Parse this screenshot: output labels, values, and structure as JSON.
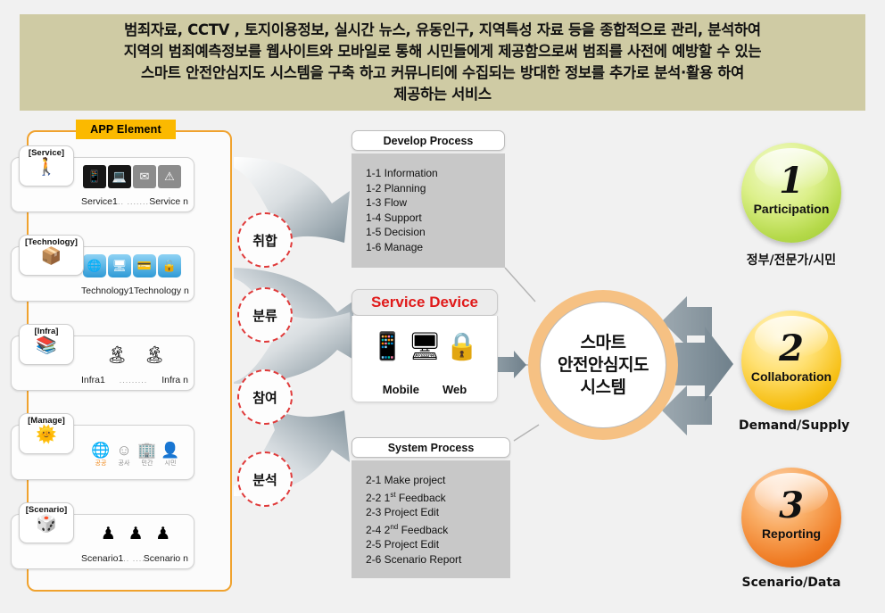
{
  "header": {
    "lines": [
      "범죄자료, CCTV , 토지이용정보, 실시간 뉴스, 유동인구, 지역특성 자료 등을 종합적으로 관리, 분석하여",
      "지역의 범죄예측정보를 웹사이트와 모바일로 통해 시민들에게 제공함으로써 범죄를 사전에 예방할 수 있는",
      "스마트 안전안심지도 시스템을 구축 하고 커뮤니티에 수집되는 방대한 정보를 추가로 분석·활용 하여",
      "제공하는 서비스"
    ],
    "bg_color": "#cfcba4"
  },
  "app_panel": {
    "tab_label": "APP Element",
    "tab_color": "#fbb900",
    "border_color": "#f0a22e",
    "rows": [
      {
        "tag": "[Service]",
        "tag_icon": "person-service-icon",
        "icons": [
          "service-icon-1",
          "service-icon-2",
          "service-icon-3",
          "service-icon-4"
        ],
        "caption_left": "Service1",
        "caption_dots": ".. .......",
        "caption_right": "Service n"
      },
      {
        "tag": "[Technology]",
        "tag_icon": "layers-icon",
        "icons": [
          "network-icon",
          "monitor-icon",
          "card-icon",
          "lock-icon"
        ],
        "caption_left": "Technology1",
        "caption_dots": "...",
        "caption_right": "Technology n"
      },
      {
        "tag": "[Infra]",
        "tag_icon": "books-icon",
        "icons": [
          "land-icon-1",
          "land-icon-2"
        ],
        "caption_left": "Infra1",
        "caption_dots": ".........",
        "caption_right": "Infra n"
      },
      {
        "tag": "[Manage]",
        "tag_icon": "manage-hand-icon",
        "icons": [
          "globe-icon",
          "smile-icon",
          "building-icon",
          "citizen-icon"
        ],
        "icon_labels": [
          "공공",
          "공사",
          "민간",
          "시민"
        ],
        "caption_left": "",
        "caption_dots": "",
        "caption_right": ""
      },
      {
        "tag": "[Scenario]",
        "tag_icon": "dice-icon",
        "icons": [
          "figure-icon-1",
          "figure-icon-2",
          "figure-icon-3"
        ],
        "caption_left": "Scenario1",
        "caption_dots": ".. .....",
        "caption_right": "Scenario n"
      }
    ]
  },
  "flow_steps": [
    {
      "label": "취합"
    },
    {
      "label": "분류"
    },
    {
      "label": "참여"
    },
    {
      "label": "분석"
    }
  ],
  "develop_process": {
    "title": "Develop Process",
    "items": [
      "1-1 Information",
      "1-2 Planning",
      "1-3 Flow",
      "1-4 Support",
      "1-5 Decision",
      "1-6 Manage"
    ]
  },
  "service_device": {
    "title": "Service Device",
    "title_color": "#e01b1b",
    "icons": [
      "mobile-map-icon",
      "monitor-icon",
      "users-lock-icon"
    ],
    "captions": [
      "Mobile",
      "Web"
    ]
  },
  "system_process": {
    "title": "System Process",
    "items": [
      {
        "text": "2-1 Make project"
      },
      {
        "text": "2-2 1",
        "sup": "st",
        "rest": " Feedback"
      },
      {
        "text": "2-3 Project Edit"
      },
      {
        "text": "2-4 2",
        "sup": "nd",
        "rest": " Feedback"
      },
      {
        "text": "2-5 Project Edit"
      },
      {
        "text": "2-6 Scenario Report"
      }
    ]
  },
  "center": {
    "lines": [
      "스마트",
      "안전안심지도",
      "시스템"
    ],
    "ring_color": "#f6c183"
  },
  "results": [
    {
      "number": "1",
      "name": "Participation",
      "sub": "정부/전문가/시민",
      "color": "#b5d94a"
    },
    {
      "number": "2",
      "name": "Collaboration",
      "sub": "Demand/Supply",
      "color": "#f6bf14"
    },
    {
      "number": "3",
      "name": "Reporting",
      "sub": "Scenario/Data",
      "color": "#ef7a22"
    }
  ]
}
